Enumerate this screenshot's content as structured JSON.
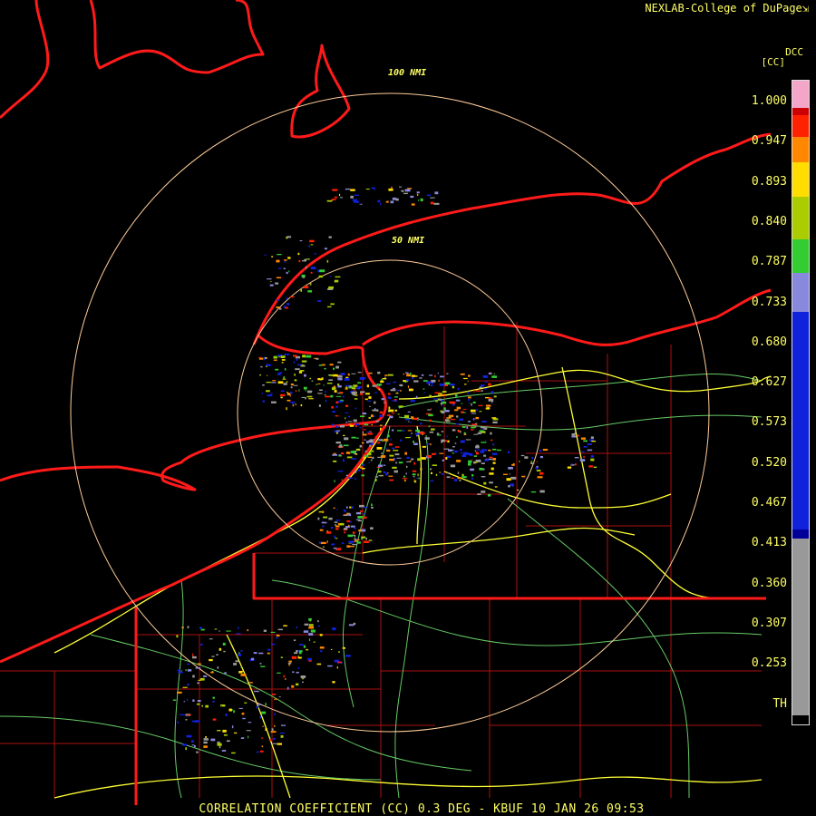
{
  "credit": "NEXLAB-College of DuPage",
  "credit_icon": "corner-logo-icon",
  "product_code": "DCC",
  "unit": "[CC]",
  "rings": {
    "inner": "50 NMI",
    "outer": "100 NMI"
  },
  "legend": {
    "ticks": [
      "1.000",
      "0.947",
      "0.893",
      "0.840",
      "0.787",
      "0.733",
      "0.680",
      "0.627",
      "0.573",
      "0.520",
      "0.467",
      "0.413",
      "0.360",
      "0.307",
      "0.253",
      "TH"
    ],
    "colors": {
      "pink": "#f4a6c8",
      "deep_red": "#cc0000",
      "red": "#ff2200",
      "orange": "#ff8800",
      "yellow": "#ffdd00",
      "yellow_green": "#aacc00",
      "green": "#33cc33",
      "light_blue": "#8888dd",
      "blue": "#1122dd",
      "dark_blue": "#000099",
      "gray": "#999999",
      "black": "#000000"
    }
  },
  "map_colors": {
    "state_border": "#ff1a1a",
    "county": "#aa1111",
    "highway": "#ffff33",
    "road": "#66cc66",
    "ring": "#ffcc99"
  },
  "caption": "CORRELATION COEFFICIENT (CC) 0.3 DEG - KBUF 10 JAN 26 09:53"
}
